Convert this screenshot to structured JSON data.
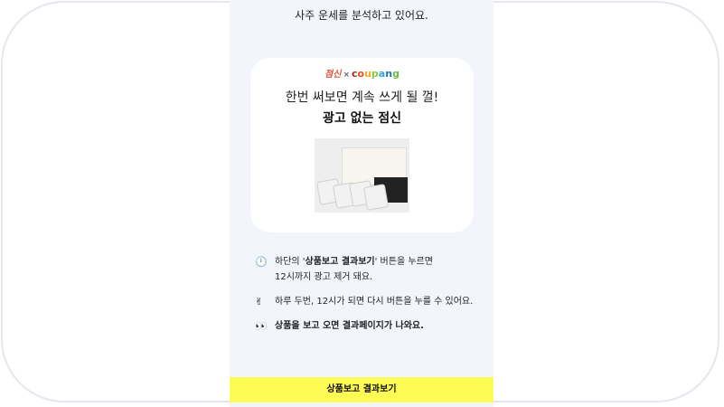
{
  "status_message": "사주 운세를 분석하고 있어요.",
  "card": {
    "brand_left": "점신",
    "brand_sep": "×",
    "brand_right": "coupang",
    "headline": "한번 써보면 계속 쓰게 될 껄!",
    "subheadline": "광고 없는 점신"
  },
  "tips": [
    {
      "icon": "info-icon",
      "text_prefix": "하단의 '",
      "text_bold": "상품보고 결과보기",
      "text_suffix": "' 버튼을 누르면",
      "text_line2": "12시까지 광고 제거 돼요."
    },
    {
      "icon": "victory-hand-icon",
      "text": "하루 두번, 12시가 되면 다시 버튼을 누를 수 있어요."
    },
    {
      "icon": "eyes-icon",
      "text_bold": "상품을 보고 오면 결과페이지가 나와요."
    }
  ],
  "cta_label": "상품보고 결과보기",
  "colors": {
    "background": "#f3f5fd",
    "cta": "#fefb55"
  }
}
